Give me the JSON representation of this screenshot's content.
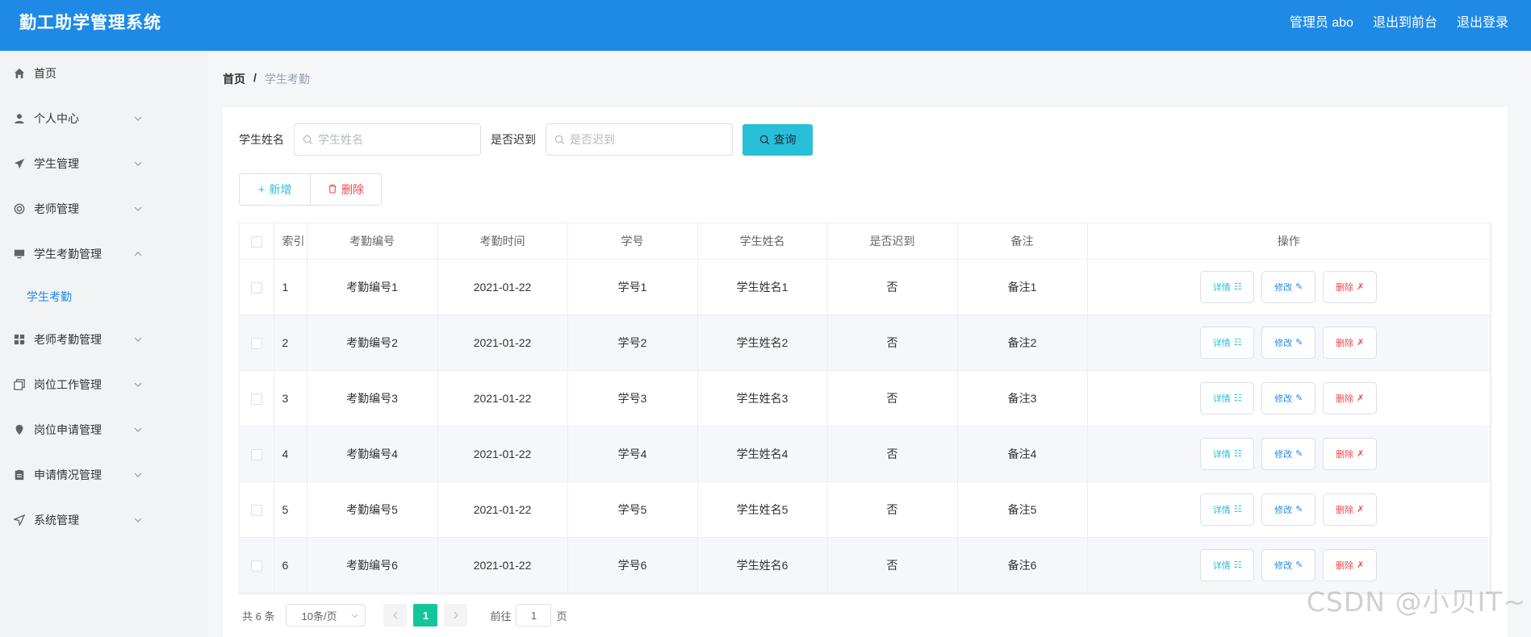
{
  "header": {
    "title": "勤工助学管理系统",
    "admin": "管理员 abo",
    "to_front": "退出到前台",
    "logout": "退出登录"
  },
  "sidebar": {
    "items": [
      {
        "label": "首页",
        "icon": "home-icon"
      },
      {
        "label": "个人中心",
        "icon": "user-icon"
      },
      {
        "label": "学生管理",
        "icon": "send-icon"
      },
      {
        "label": "老师管理",
        "icon": "lifebuoy-icon"
      },
      {
        "label": "学生考勤管理",
        "icon": "monitor-icon",
        "expanded": true
      },
      {
        "label": "老师考勤管理",
        "icon": "grid-icon"
      },
      {
        "label": "岗位工作管理",
        "icon": "copy-icon"
      },
      {
        "label": "岗位申请管理",
        "icon": "location-icon"
      },
      {
        "label": "申请情况管理",
        "icon": "clipboard-icon"
      },
      {
        "label": "系统管理",
        "icon": "navigation-icon"
      }
    ],
    "submenu": {
      "label": "学生考勤"
    }
  },
  "breadcrumb": {
    "home": "首页",
    "sep": "/",
    "current": "学生考勤"
  },
  "search": {
    "name_label": "学生姓名",
    "name_placeholder": "学生姓名",
    "late_label": "是否迟到",
    "late_placeholder": "是否迟到",
    "button": "查询"
  },
  "actions": {
    "add": "新增",
    "delete": "删除"
  },
  "table": {
    "headers": [
      "索引",
      "考勤编号",
      "考勤时间",
      "学号",
      "学生姓名",
      "是否迟到",
      "备注",
      "操作"
    ],
    "rows": [
      [
        "1",
        "考勤编号1",
        "2021-01-22",
        "学号1",
        "学生姓名1",
        "否",
        "备注1"
      ],
      [
        "2",
        "考勤编号2",
        "2021-01-22",
        "学号2",
        "学生姓名2",
        "否",
        "备注2"
      ],
      [
        "3",
        "考勤编号3",
        "2021-01-22",
        "学号3",
        "学生姓名3",
        "否",
        "备注3"
      ],
      [
        "4",
        "考勤编号4",
        "2021-01-22",
        "学号4",
        "学生姓名4",
        "否",
        "备注4"
      ],
      [
        "5",
        "考勤编号5",
        "2021-01-22",
        "学号5",
        "学生姓名5",
        "否",
        "备注5"
      ],
      [
        "6",
        "考勤编号6",
        "2021-01-22",
        "学号6",
        "学生姓名6",
        "否",
        "备注6"
      ]
    ],
    "op_labels": {
      "detail": "详情",
      "edit": "修改",
      "remove": "删除"
    }
  },
  "pagination": {
    "total": "共 6 条",
    "page_size": "10条/页",
    "current_page": "1",
    "goto_label": "前往",
    "goto_value": "1",
    "goto_unit": "页"
  },
  "watermark": "CSDN @小贝IT~",
  "colors": {
    "header_bg": "#1e8ae6",
    "accent_cyan": "#27c0d8",
    "danger": "#f04848",
    "page_active": "#13c59a"
  }
}
